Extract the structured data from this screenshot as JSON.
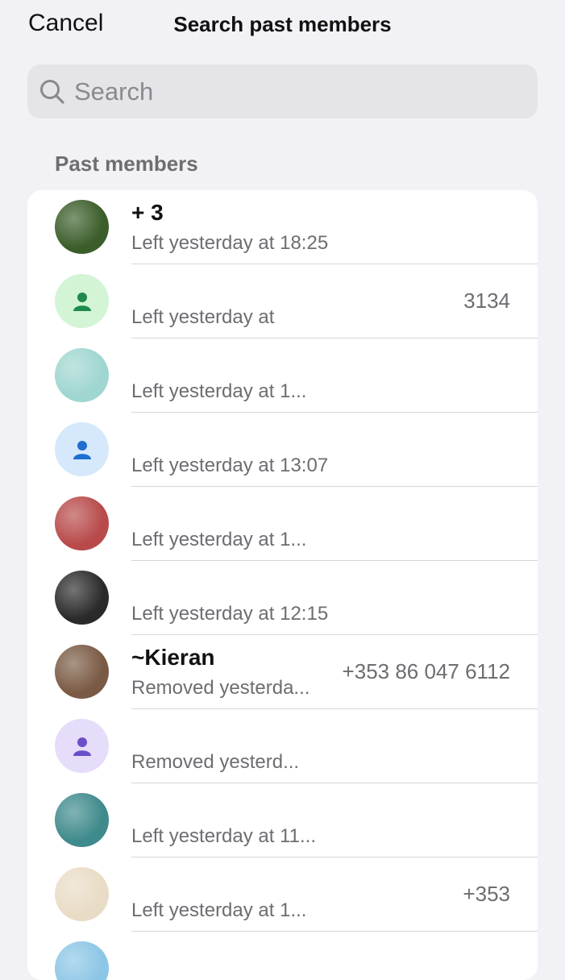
{
  "nav": {
    "cancel_label": "Cancel",
    "title": "Search past members"
  },
  "search": {
    "placeholder": "Search",
    "icon": "search-icon"
  },
  "section": {
    "header": "Past members"
  },
  "members": [
    {
      "name": "+ 3",
      "status": "Left yesterday at 18:25",
      "phone": "",
      "avatar": "photo-avatar",
      "color": "#3b5d2a"
    },
    {
      "name": "",
      "status": "Left yesterday at",
      "phone": "3134",
      "avatar": "person-icon",
      "color": "#1f8a4c",
      "bg": "#d3f5d6"
    },
    {
      "name": "",
      "status": "Left yesterday at 1...",
      "phone": "",
      "avatar": "photo-avatar",
      "color": "#9fd6d0"
    },
    {
      "name": "",
      "status": "Left yesterday at 13:07",
      "phone": "",
      "avatar": "person-icon",
      "color": "#1e6fd0",
      "bg": "#d6e8fb"
    },
    {
      "name": "",
      "status": "Left yesterday at 1...",
      "phone": "",
      "avatar": "photo-avatar",
      "color": "#b84a4a"
    },
    {
      "name": "",
      "status": "Left yesterday at 12:15",
      "phone": "",
      "avatar": "photo-avatar",
      "color": "#2a2a2a"
    },
    {
      "name": "~Kieran",
      "status": "Removed yesterda...",
      "phone": "+353 86 047 6112",
      "avatar": "photo-avatar",
      "color": "#7a5a44"
    },
    {
      "name": "",
      "status": "Removed yesterd...",
      "phone": "",
      "avatar": "person-icon",
      "color": "#6b4fc9",
      "bg": "#e6ddfa"
    },
    {
      "name": "",
      "status": "Left yesterday at 11...",
      "phone": "",
      "avatar": "photo-avatar",
      "color": "#3f8a8c"
    },
    {
      "name": "",
      "status": "Left yesterday at 1...",
      "phone": "+353",
      "avatar": "photo-avatar",
      "color": "#e9dcc6"
    },
    {
      "name": "",
      "status": "",
      "phone": "",
      "avatar": "photo-avatar",
      "color": "#8cc6e6"
    }
  ]
}
